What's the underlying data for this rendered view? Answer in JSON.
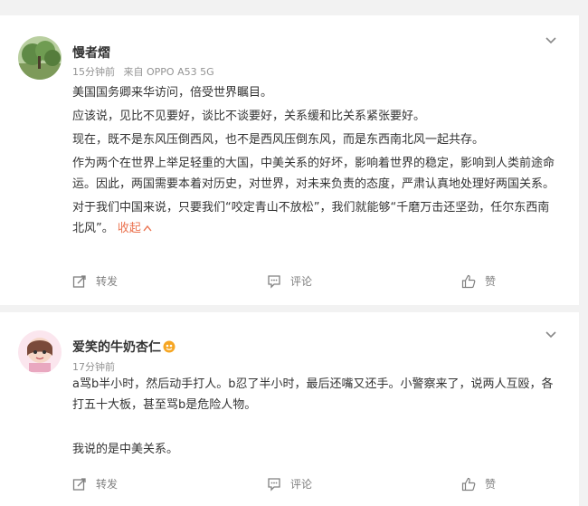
{
  "comments": [
    {
      "username": "慢者熠",
      "time": "15分钟前",
      "source": "来自 OPPO A53 5G",
      "paragraphs": [
        "美国国务卿来华访问，倍受世界瞩目。",
        "应该说，见比不见要好，谈比不谈要好，关系缓和比关系紧张要好。",
        "现在，既不是东风压倒西风，也不是西风压倒东风，而是东西南北风一起共存。",
        "作为两个在世界上举足轻重的大国，中美关系的好坏，影响着世界的稳定，影响到人类前途命运。因此，两国需要本着对历史，对世界，对未来负责的态度，严肃认真地处理好两国关系。",
        "对于我们中国来说，只要我们“咬定青山不放松”，我们就能够“千磨万击还坚劲，任尔东西南北风”。"
      ],
      "collapse_label": "收起",
      "actions": {
        "repost": "转发",
        "comment": "评论",
        "like": "赞"
      }
    },
    {
      "username": "爱笑的牛奶杏仁",
      "time": "17分钟前",
      "paragraphs": [
        "a骂b半小时，然后动手打人。b忍了半小时，最后还嘴又还手。小警察来了，说两人互殴，各打五十大板，甚至骂b是危险人物。",
        "",
        "我说的是中美关系。"
      ],
      "actions": {
        "repost": "转发",
        "comment": "评论",
        "like": "赞"
      }
    }
  ],
  "colors": {
    "accent": "#eb7350",
    "meta": "#939393",
    "action": "#808080"
  },
  "icons": [
    "chevron-down-icon",
    "repost-icon",
    "comment-icon",
    "like-icon",
    "fan-badge-icon"
  ]
}
